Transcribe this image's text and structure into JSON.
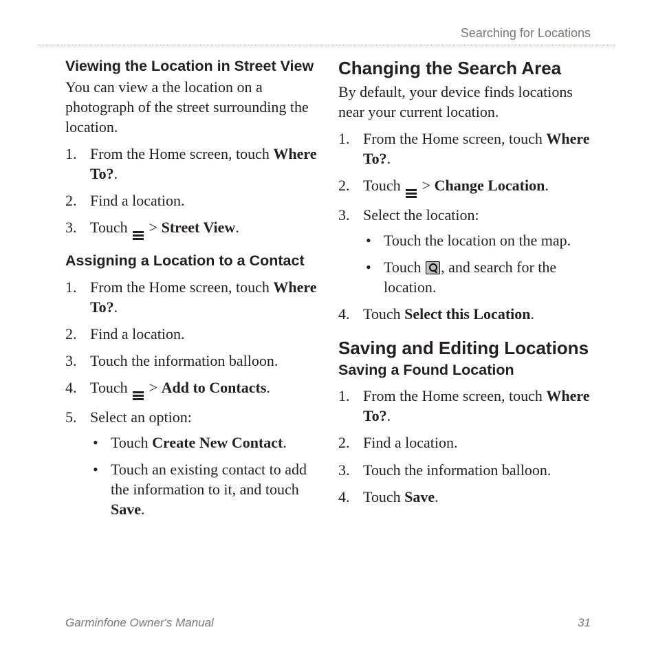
{
  "header": {
    "section": "Searching for Locations"
  },
  "footer": {
    "manual": "Garminfone Owner's Manual",
    "page": "31"
  },
  "left": {
    "sec1": {
      "title": "Viewing the Location in Street View",
      "intro": "You can view a the location on a photograph of the street surrounding the location.",
      "step1a": "From the Home screen, touch ",
      "step1b": "Where To?",
      "step1c": ".",
      "step2": "Find a location.",
      "step3a": "Touch ",
      "step3b": " > ",
      "step3c": "Street View",
      "step3d": "."
    },
    "sec2": {
      "title": "Assigning a Location to a Contact",
      "step1a": "From the Home screen, touch ",
      "step1b": "Where To?",
      "step1c": ".",
      "step2": "Find a location.",
      "step3": "Touch the information balloon.",
      "step4a": "Touch ",
      "step4b": " > ",
      "step4c": "Add to Contacts",
      "step4d": ".",
      "step5": "Select an option:",
      "sub1a": "Touch ",
      "sub1b": "Create New Contact",
      "sub1c": ".",
      "sub2a": "Touch an existing contact to add the information to it, and touch ",
      "sub2b": "Save",
      "sub2c": "."
    }
  },
  "right": {
    "sec1": {
      "title": "Changing the Search Area",
      "intro": "By default, your device finds locations near your current location.",
      "step1a": "From the Home screen, touch ",
      "step1b": "Where To?",
      "step1c": ".",
      "step2a": "Touch ",
      "step2b": " > ",
      "step2c": "Change Location",
      "step2d": ".",
      "step3": "Select the location:",
      "sub1": "Touch the location on the map.",
      "sub2a": "Touch ",
      "sub2b": ", and search for the location.",
      "step4a": "Touch ",
      "step4b": "Select this Location",
      "step4c": "."
    },
    "sec2": {
      "title": "Saving and Editing Locations",
      "sub_title": "Saving a Found Location",
      "step1a": "From the Home screen, touch ",
      "step1b": "Where To?",
      "step1c": ".",
      "step2": "Find a location.",
      "step3": "Touch the information balloon.",
      "step4a": "Touch ",
      "step4b": "Save",
      "step4c": "."
    }
  }
}
